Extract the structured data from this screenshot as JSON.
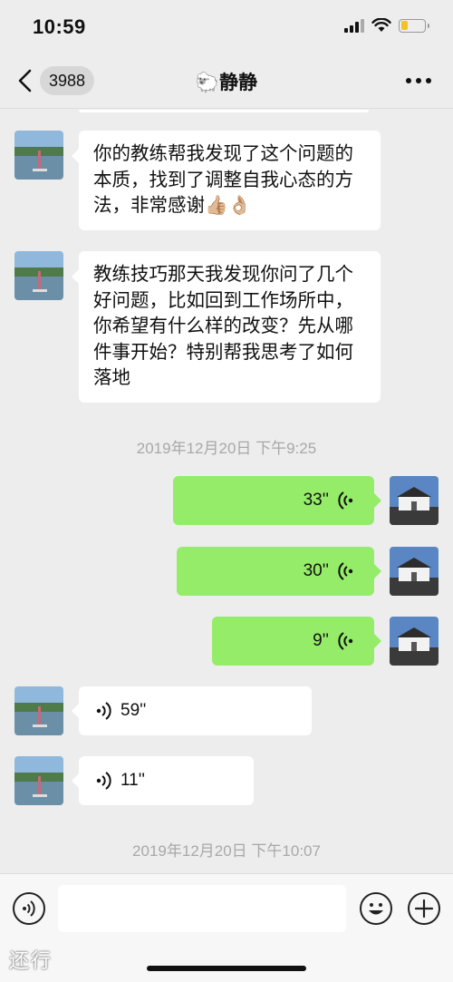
{
  "status_bar": {
    "time": "10:59"
  },
  "nav": {
    "unread_count": "3988",
    "title": "🐑静静"
  },
  "messages": [
    {
      "side": "left",
      "type": "text",
      "text": "你的教练帮我发现了这个问题的本质，找到了调整自我心态的方法，非常感谢👍🏼👌🏼"
    },
    {
      "side": "left",
      "type": "text",
      "text": "教练技巧那天我发现你问了几个好问题，比如回到工作场所中，你希望有什么样的改变？先从哪件事开始？特别帮我思考了如何落地"
    },
    {
      "type": "timestamp",
      "text": "2019年12月20日 下午9:25"
    },
    {
      "side": "right",
      "type": "voice",
      "duration": "33''"
    },
    {
      "side": "right",
      "type": "voice",
      "duration": "30''"
    },
    {
      "side": "right",
      "type": "voice",
      "duration": "9''"
    },
    {
      "side": "left",
      "type": "voice",
      "duration": "59''"
    },
    {
      "side": "left",
      "type": "voice",
      "duration": "11''"
    },
    {
      "type": "timestamp",
      "text": "2019年12月20日 下午10:07"
    }
  ],
  "input": {
    "value": ""
  },
  "watermark": "还行",
  "colors": {
    "self_bubble": "#95ec69",
    "other_bubble": "#ffffff",
    "background": "#ededed",
    "battery": "#f5c12b"
  },
  "icons": [
    "back-chevron-icon",
    "more-icon",
    "voice-wave-icon",
    "voice-input-icon",
    "emoji-icon",
    "plus-icon"
  ]
}
